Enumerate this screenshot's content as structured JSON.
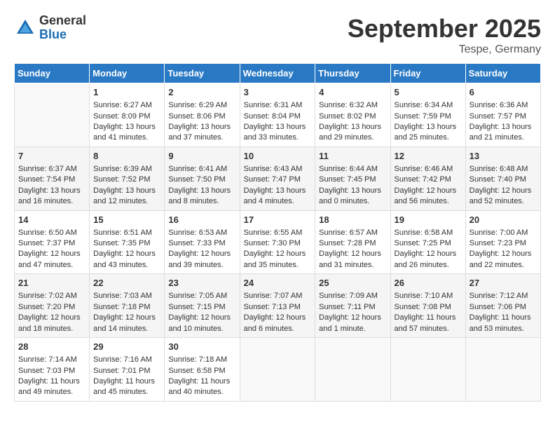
{
  "logo": {
    "general": "General",
    "blue": "Blue"
  },
  "title": {
    "month": "September 2025",
    "location": "Tespe, Germany"
  },
  "headers": [
    "Sunday",
    "Monday",
    "Tuesday",
    "Wednesday",
    "Thursday",
    "Friday",
    "Saturday"
  ],
  "weeks": [
    [
      {
        "day": "",
        "info": ""
      },
      {
        "day": "1",
        "info": "Sunrise: 6:27 AM\nSunset: 8:09 PM\nDaylight: 13 hours\nand 41 minutes."
      },
      {
        "day": "2",
        "info": "Sunrise: 6:29 AM\nSunset: 8:06 PM\nDaylight: 13 hours\nand 37 minutes."
      },
      {
        "day": "3",
        "info": "Sunrise: 6:31 AM\nSunset: 8:04 PM\nDaylight: 13 hours\nand 33 minutes."
      },
      {
        "day": "4",
        "info": "Sunrise: 6:32 AM\nSunset: 8:02 PM\nDaylight: 13 hours\nand 29 minutes."
      },
      {
        "day": "5",
        "info": "Sunrise: 6:34 AM\nSunset: 7:59 PM\nDaylight: 13 hours\nand 25 minutes."
      },
      {
        "day": "6",
        "info": "Sunrise: 6:36 AM\nSunset: 7:57 PM\nDaylight: 13 hours\nand 21 minutes."
      }
    ],
    [
      {
        "day": "7",
        "info": "Sunrise: 6:37 AM\nSunset: 7:54 PM\nDaylight: 13 hours\nand 16 minutes."
      },
      {
        "day": "8",
        "info": "Sunrise: 6:39 AM\nSunset: 7:52 PM\nDaylight: 13 hours\nand 12 minutes."
      },
      {
        "day": "9",
        "info": "Sunrise: 6:41 AM\nSunset: 7:50 PM\nDaylight: 13 hours\nand 8 minutes."
      },
      {
        "day": "10",
        "info": "Sunrise: 6:43 AM\nSunset: 7:47 PM\nDaylight: 13 hours\nand 4 minutes."
      },
      {
        "day": "11",
        "info": "Sunrise: 6:44 AM\nSunset: 7:45 PM\nDaylight: 13 hours\nand 0 minutes."
      },
      {
        "day": "12",
        "info": "Sunrise: 6:46 AM\nSunset: 7:42 PM\nDaylight: 12 hours\nand 56 minutes."
      },
      {
        "day": "13",
        "info": "Sunrise: 6:48 AM\nSunset: 7:40 PM\nDaylight: 12 hours\nand 52 minutes."
      }
    ],
    [
      {
        "day": "14",
        "info": "Sunrise: 6:50 AM\nSunset: 7:37 PM\nDaylight: 12 hours\nand 47 minutes."
      },
      {
        "day": "15",
        "info": "Sunrise: 6:51 AM\nSunset: 7:35 PM\nDaylight: 12 hours\nand 43 minutes."
      },
      {
        "day": "16",
        "info": "Sunrise: 6:53 AM\nSunset: 7:33 PM\nDaylight: 12 hours\nand 39 minutes."
      },
      {
        "day": "17",
        "info": "Sunrise: 6:55 AM\nSunset: 7:30 PM\nDaylight: 12 hours\nand 35 minutes."
      },
      {
        "day": "18",
        "info": "Sunrise: 6:57 AM\nSunset: 7:28 PM\nDaylight: 12 hours\nand 31 minutes."
      },
      {
        "day": "19",
        "info": "Sunrise: 6:58 AM\nSunset: 7:25 PM\nDaylight: 12 hours\nand 26 minutes."
      },
      {
        "day": "20",
        "info": "Sunrise: 7:00 AM\nSunset: 7:23 PM\nDaylight: 12 hours\nand 22 minutes."
      }
    ],
    [
      {
        "day": "21",
        "info": "Sunrise: 7:02 AM\nSunset: 7:20 PM\nDaylight: 12 hours\nand 18 minutes."
      },
      {
        "day": "22",
        "info": "Sunrise: 7:03 AM\nSunset: 7:18 PM\nDaylight: 12 hours\nand 14 minutes."
      },
      {
        "day": "23",
        "info": "Sunrise: 7:05 AM\nSunset: 7:15 PM\nDaylight: 12 hours\nand 10 minutes."
      },
      {
        "day": "24",
        "info": "Sunrise: 7:07 AM\nSunset: 7:13 PM\nDaylight: 12 hours\nand 6 minutes."
      },
      {
        "day": "25",
        "info": "Sunrise: 7:09 AM\nSunset: 7:11 PM\nDaylight: 12 hours\nand 1 minute."
      },
      {
        "day": "26",
        "info": "Sunrise: 7:10 AM\nSunset: 7:08 PM\nDaylight: 11 hours\nand 57 minutes."
      },
      {
        "day": "27",
        "info": "Sunrise: 7:12 AM\nSunset: 7:06 PM\nDaylight: 11 hours\nand 53 minutes."
      }
    ],
    [
      {
        "day": "28",
        "info": "Sunrise: 7:14 AM\nSunset: 7:03 PM\nDaylight: 11 hours\nand 49 minutes."
      },
      {
        "day": "29",
        "info": "Sunrise: 7:16 AM\nSunset: 7:01 PM\nDaylight: 11 hours\nand 45 minutes."
      },
      {
        "day": "30",
        "info": "Sunrise: 7:18 AM\nSunset: 6:58 PM\nDaylight: 11 hours\nand 40 minutes."
      },
      {
        "day": "",
        "info": ""
      },
      {
        "day": "",
        "info": ""
      },
      {
        "day": "",
        "info": ""
      },
      {
        "day": "",
        "info": ""
      }
    ]
  ]
}
